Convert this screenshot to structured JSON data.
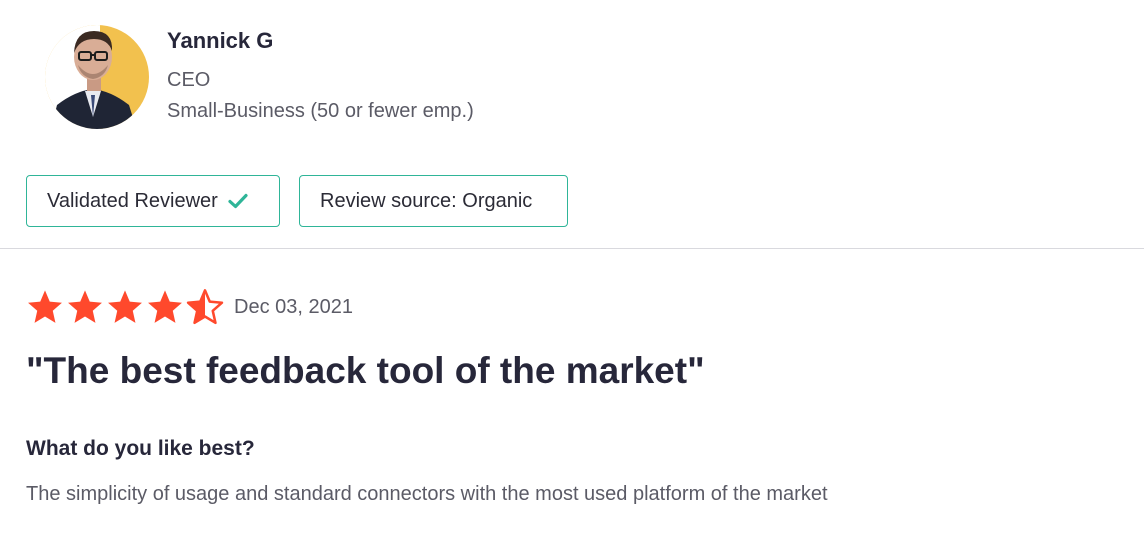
{
  "reviewer": {
    "name": "Yannick G",
    "role": "CEO",
    "company_size": "Small-Business (50 or fewer emp.)"
  },
  "badges": {
    "validated": "Validated Reviewer",
    "source": "Review source: Organic"
  },
  "review": {
    "rating": 4.5,
    "rating_max": 5,
    "date": "Dec 03, 2021",
    "title": "\"The best feedback tool of the market\"",
    "question": "What do you like best?",
    "answer": "The simplicity of usage and standard connectors with the most used platform of the market"
  },
  "colors": {
    "star": "#ff492c",
    "badge_border": "#2fb598",
    "check": "#2fb598",
    "avatar_bg": "#f2c14e"
  },
  "icons": {
    "check": "check-icon",
    "star": "star-icon",
    "avatar": "avatar"
  }
}
